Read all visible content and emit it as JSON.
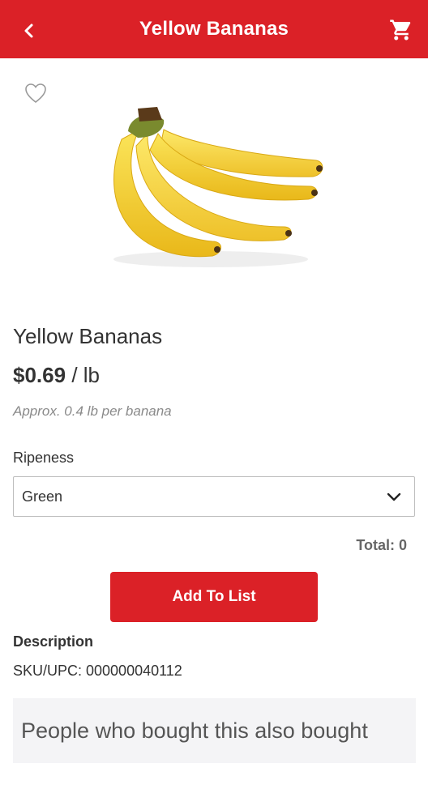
{
  "header": {
    "title": "Yellow Bananas",
    "back_icon": "chevron-left-icon",
    "cart_icon": "cart-icon",
    "background": "#db2127"
  },
  "product": {
    "favorite_icon": "heart-outline-icon",
    "image": "yellow-bananas-image",
    "name": "Yellow Bananas",
    "price": "$0.69",
    "unit": "/ lb",
    "approx": "Approx. 0.4 lb per banana"
  },
  "options": {
    "ripeness_label": "Ripeness",
    "ripeness_selected": "Green"
  },
  "total": "Total: 0",
  "actions": {
    "add_to_list": "Add To List",
    "accent": "#db2127"
  },
  "description": {
    "heading": "Description",
    "sku": "SKU/UPC: 000000040112"
  },
  "recommendations": {
    "heading": "People who bought this also bought"
  }
}
